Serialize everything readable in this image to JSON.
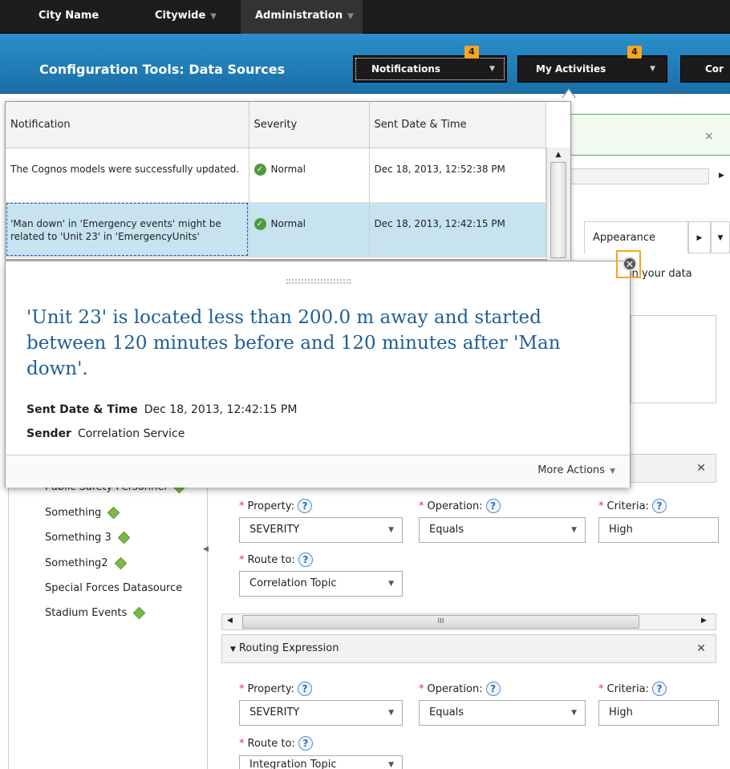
{
  "topnav": {
    "city": "City Name",
    "citywide": "Citywide",
    "admin": "Administration"
  },
  "header": {
    "title": "Configuration Tools: Data Sources",
    "notifications_label": "Notifications",
    "notifications_count": "4",
    "activities_label": "My Activities",
    "activities_count": "4",
    "con_label": "Cor"
  },
  "notifications": {
    "columns": [
      "Notification",
      "Severity",
      "Sent Date & Time"
    ],
    "rows": [
      {
        "text": "The Cognos models were successfully updated.",
        "severity": "Normal",
        "sent": "Dec 18, 2013, 12:52:38 PM"
      },
      {
        "text": "'Man down' in 'Emergency events' might be related to 'Unit 23' in 'EmergencyUnits'",
        "severity": "Normal",
        "sent": "Dec 18, 2013, 12:42:15 PM"
      }
    ]
  },
  "detail": {
    "message": "'Unit 23' is located less than 200.0 m away and started between 120 minutes before and 120 minutes after 'Man down'.",
    "sent_label": "Sent Date & Time",
    "sent_value": "Dec 18, 2013, 12:42:15 PM",
    "sender_label": "Sender",
    "sender_value": "Correlation Service",
    "more_actions": "More Actions"
  },
  "background": {
    "tab_appearance": "Appearance",
    "partial_text": "in your data",
    "close_x": "×"
  },
  "sources": {
    "items": [
      {
        "label": "Public Safety Personnel",
        "ok": true
      },
      {
        "label": "Something",
        "ok": true
      },
      {
        "label": "Something 3",
        "ok": true
      },
      {
        "label": "Something2",
        "ok": true
      },
      {
        "label": "Special Forces Datasource",
        "ok": false
      },
      {
        "label": "Stadium Events",
        "ok": true
      }
    ]
  },
  "routing": {
    "section_title": "Routing Expression",
    "property_label": "Property:",
    "operation_label": "Operation:",
    "criteria_label": "Criteria:",
    "route_label": "Route to:",
    "expr1": {
      "property": "SEVERITY",
      "operation": "Equals",
      "criteria": "High",
      "route": "Correlation Topic"
    },
    "expr2": {
      "property": "SEVERITY",
      "operation": "Equals",
      "criteria": "High",
      "route": "Integration Topic"
    }
  }
}
